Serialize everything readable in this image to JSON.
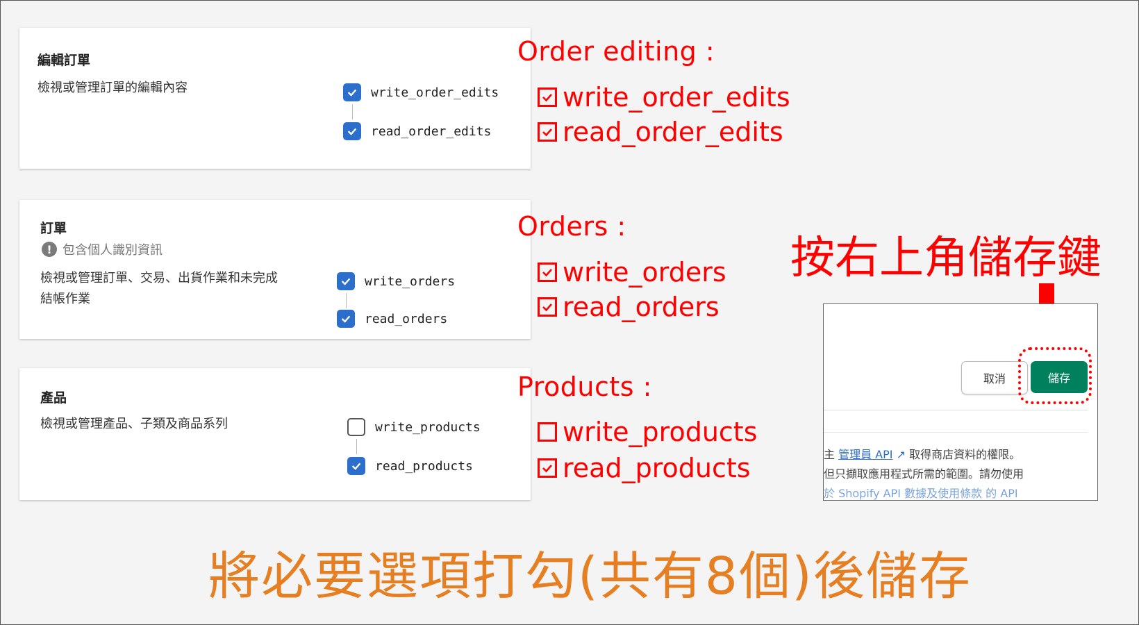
{
  "cards": {
    "order_editing": {
      "title": "編輯訂單",
      "description": "檢視或管理訂單的編輯內容",
      "permissions": [
        {
          "label": "write_order_edits",
          "checked": true
        },
        {
          "label": "read_order_edits",
          "checked": true
        }
      ]
    },
    "orders": {
      "title": "訂單",
      "pii_note": "包含個人識別資訊",
      "description_line1": "檢視或管理訂單、交易、出貨作業和未完成",
      "description_line2": "結帳作業",
      "permissions": [
        {
          "label": "write_orders",
          "checked": true
        },
        {
          "label": "read_orders",
          "checked": true
        }
      ]
    },
    "products": {
      "title": "產品",
      "description": "檢視或管理產品、子類及商品系列",
      "permissions": [
        {
          "label": "write_products",
          "checked": false
        },
        {
          "label": "read_products",
          "checked": true
        }
      ]
    }
  },
  "annotations": {
    "order_editing": {
      "title": "Order editing :",
      "items": [
        {
          "label": "write_order_edits",
          "checked": true
        },
        {
          "label": "read_order_edits",
          "checked": true
        }
      ]
    },
    "orders": {
      "title": "Orders :",
      "items": [
        {
          "label": "write_orders",
          "checked": true
        },
        {
          "label": "read_orders",
          "checked": true
        }
      ]
    },
    "products": {
      "title": "Products :",
      "items": [
        {
          "label": "write_products",
          "checked": false
        },
        {
          "label": "read_products",
          "checked": true
        }
      ]
    }
  },
  "save_hint": "按右上角儲存鍵",
  "inset": {
    "cancel_label": "取消",
    "save_label": "儲存",
    "line1_prefix": "主 ",
    "line1_link": "管理員 API",
    "line1_suffix": "  取得商店資料的權限。",
    "line2": "但只擷取應用程式所需的範圍。請勿使用",
    "line3": "於 Shopify API 數據及使用條款 的 API"
  },
  "bottom_caption": "將必要選項打勾(共有8個)後儲存",
  "colors": {
    "accent_red": "#ff0000",
    "caption_orange": "#e67e22",
    "checkbox_blue": "#2c6ecb",
    "save_green": "#00805c"
  }
}
